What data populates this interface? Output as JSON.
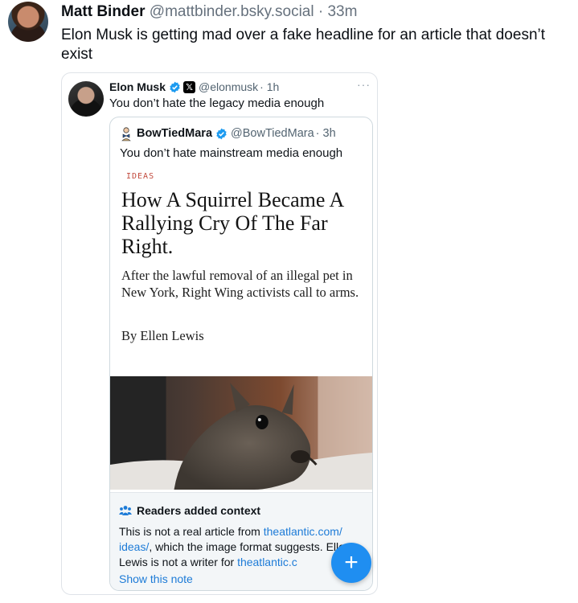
{
  "post": {
    "author": "Matt Binder",
    "handle": "@mattbinder.bsky.social",
    "time": "· 33m",
    "text": "Elon Musk is getting mad over a fake headline for an article that doesn’t exist"
  },
  "embed": {
    "author": "Elon Musk",
    "handle": "@elonmusk",
    "time": "· 1h",
    "text": "You don’t hate the legacy media enough",
    "more_icon": "···"
  },
  "quote": {
    "author": "BowTiedMara",
    "handle": "@BowTiedMara",
    "time": "· 3h",
    "text": "You don’t hate mainstream media enough"
  },
  "article": {
    "tag": "IDEAS",
    "title": "How A Squirrel Became A Rallying Cry Of The Far Right.",
    "subtitle": "After the lawful removal of an illegal pet in New York, Right Wing activists call to arms.",
    "byline": "By Ellen Lewis"
  },
  "context": {
    "heading": "Readers added context",
    "body_1": "This is not a real article from ",
    "link_1": "theatlantic.com/ ideas/",
    "body_2": ", which the image format suggests. Ellen Lewis is not a writer for ",
    "link_2": "theatlantic.c",
    "show_note": "Show this note"
  },
  "fab": {
    "label": "+"
  },
  "colors": {
    "link": "#1d7bd7",
    "verified": "#1d9bf0",
    "fab": "#1f8ef1",
    "tag": "#c24a3d"
  },
  "icons": {
    "verified": "verified-badge-icon",
    "x": "x-logo-icon",
    "people": "people-icon",
    "plus": "plus-icon"
  }
}
